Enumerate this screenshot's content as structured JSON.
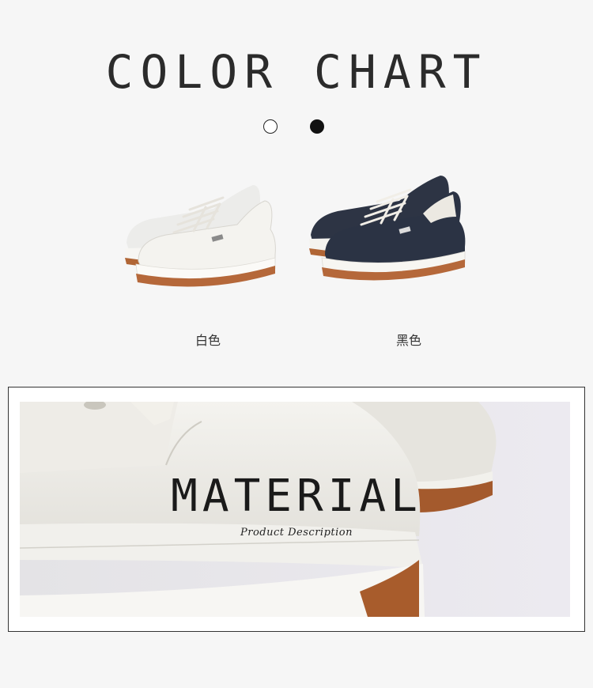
{
  "header": {
    "title": "COLOR CHART"
  },
  "swatches": [
    {
      "name": "white",
      "color": "#ffffff"
    },
    {
      "name": "black",
      "color": "#111111"
    }
  ],
  "variants": [
    {
      "label": "白色",
      "upper_color": "#f4f3ef",
      "sole_color": "#b5683a"
    },
    {
      "label": "黑色",
      "upper_color": "#2b3344",
      "sole_color": "#b5683a"
    }
  ],
  "material": {
    "title": "MATERIAL",
    "subtitle": "Product Description"
  }
}
